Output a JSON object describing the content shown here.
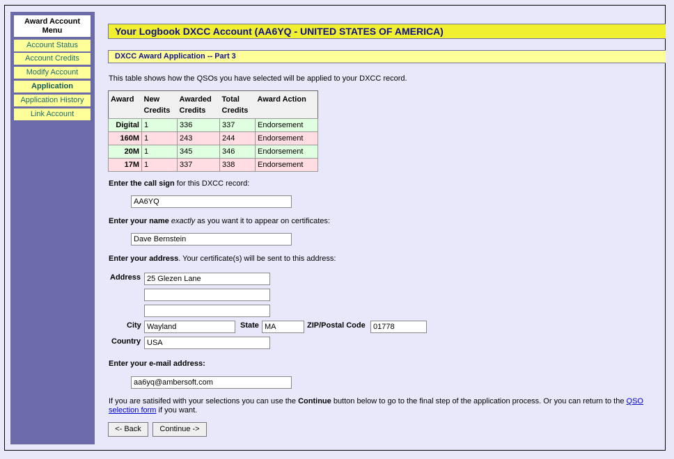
{
  "sidebar": {
    "title": "Award Account Menu",
    "items": [
      {
        "label": "Account Status",
        "active": false
      },
      {
        "label": "Account Credits",
        "active": false
      },
      {
        "label": "Modify Account",
        "active": false
      },
      {
        "label": "Application",
        "active": true
      },
      {
        "label": "Application History",
        "active": false
      },
      {
        "label": "Link Account",
        "active": false
      }
    ]
  },
  "header": {
    "title": "Your Logbook DXCC Account (AA6YQ - UNITED STATES OF AMERICA)",
    "subtitle": "DXCC Award Application -- Part 3"
  },
  "intro": "This table shows how the QSOs you have selected will be applied to your DXCC record.",
  "table": {
    "headers": {
      "award": "Award",
      "new_credits_1": "New",
      "new_credits_2": "Credits",
      "awarded_1": "Awarded",
      "awarded_2": "Credits",
      "total_1": "Total",
      "total_2": "Credits",
      "action": "Award Action"
    },
    "rows": [
      {
        "award": "Digital",
        "new": "1",
        "awarded": "336",
        "total": "337",
        "action": "Endorsement",
        "color": "green"
      },
      {
        "award": "160M",
        "new": "1",
        "awarded": "243",
        "total": "244",
        "action": "Endorsement",
        "color": "pink"
      },
      {
        "award": "20M",
        "new": "1",
        "awarded": "345",
        "total": "346",
        "action": "Endorsement",
        "color": "green"
      },
      {
        "award": "17M",
        "new": "1",
        "awarded": "337",
        "total": "338",
        "action": "Endorsement",
        "color": "pink"
      }
    ]
  },
  "form": {
    "callsign_prompt_bold": "Enter the call sign",
    "callsign_prompt_rest": " for this DXCC record:",
    "callsign_value": "AA6YQ",
    "name_prompt_bold": "Enter your name",
    "name_prompt_em": "exactly",
    "name_prompt_rest": " as you want it to appear on certificates:",
    "name_value": "Dave Bernstein",
    "address_prompt_bold": "Enter your address",
    "address_prompt_rest": ". Your certificate(s) will be sent to this address:",
    "address_label": "Address",
    "address_line1": "25 Glezen Lane",
    "address_line2": "",
    "address_line3": "",
    "city_label": "City",
    "city_value": "Wayland",
    "state_label": "State",
    "state_value": "MA",
    "zip_label": "ZIP/Postal Code",
    "zip_value": "01778",
    "country_label": "Country",
    "country_value": "USA",
    "email_prompt": "Enter your e-mail address:",
    "email_value": "aa6yq@ambersoft.com"
  },
  "footer": {
    "text_1": "If you are satisifed with your selections you can use the ",
    "text_bold": "Continue",
    "text_2": " button below to go to the final step of the application process. Or you can return to the ",
    "link_1": "QSO",
    "link_2": "selection form",
    "text_3": " if you want.",
    "back_label": "<- Back",
    "continue_label": "Continue ->"
  }
}
